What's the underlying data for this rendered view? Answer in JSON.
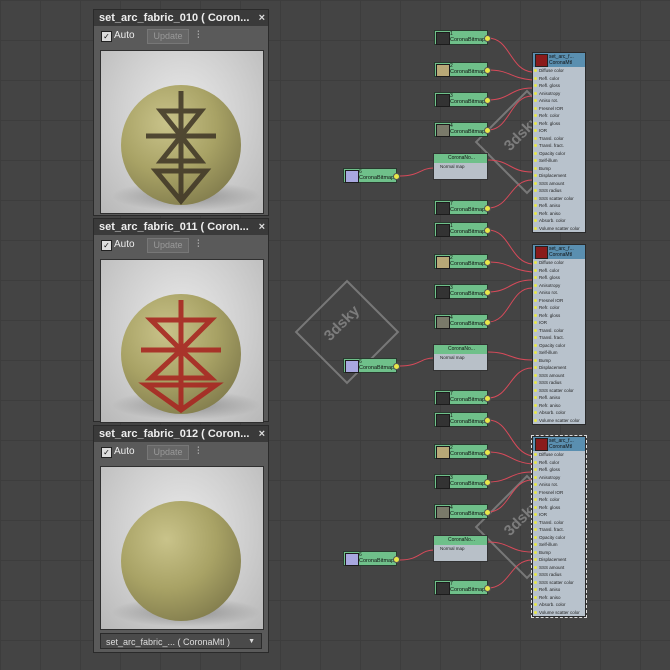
{
  "panels": [
    {
      "title": "set_arc_fabric_010  ( Coron...",
      "auto": "Auto",
      "update": "Update",
      "pattern_color": "#3d3425"
    },
    {
      "title": "set_arc_fabric_011  ( Coron...",
      "auto": "Auto",
      "update": "Update",
      "pattern_color": "#a82722"
    },
    {
      "title": "set_arc_fabric_012  ( Coron...",
      "auto": "Auto",
      "update": "Update",
      "pattern_color": "none"
    }
  ],
  "material_select": "set_arc_fabric_...  ( CoronaMtl )",
  "close_glyph": "×",
  "check_glyph": "✓",
  "dropdown_glyph": "▼",
  "watermark": "3dsky",
  "bitmap_label": "CoronaBitmap",
  "normal_label": "CoronaNo...",
  "normal_rows": [
    "Normal map",
    "Additional bump"
  ],
  "mtl_title": "set_arc_f...",
  "mtl_type": "CoronaMtl",
  "mtl_slots": [
    "Diffuse color",
    "Refl. color",
    "Refl. gloss",
    "Anisotropy",
    "Aniso rot.",
    "Fresnel IOR",
    "Refr. color",
    "Refr. gloss",
    "IOR",
    "Transl. color",
    "Transl. fract.",
    "Opacity color",
    "Self-illum",
    "Bump",
    "Displacement",
    "SSS amount",
    "SSS radius",
    "SSS scatter color",
    "Refl. aniso",
    "Refr. aniso",
    "Absorb. color",
    "Volume scatter color"
  ],
  "bitmap_numbers": [
    "1",
    "2",
    "3",
    "4",
    "5",
    "6",
    "7"
  ]
}
